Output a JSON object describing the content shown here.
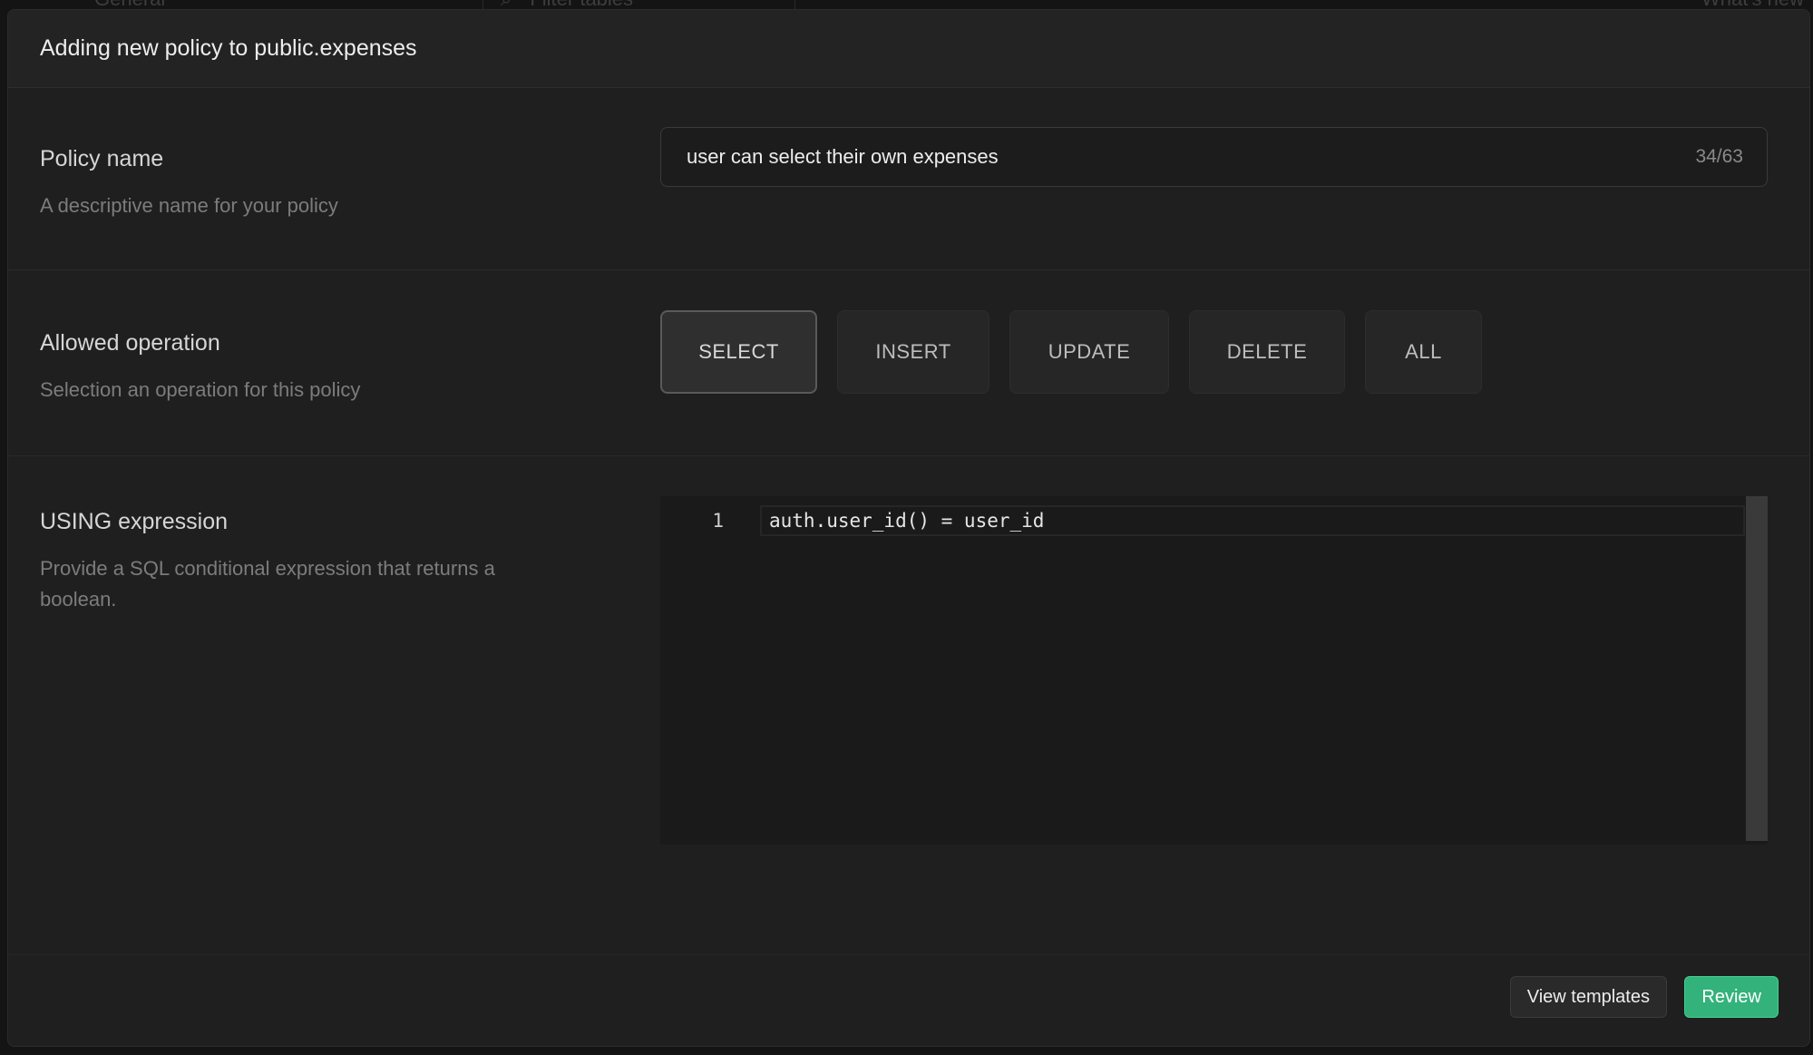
{
  "background": {
    "tab_label": "General",
    "filter_placeholder": "Filter tables",
    "whats_new": "What's new"
  },
  "modal": {
    "title": "Adding new policy to public.expenses",
    "policy_name": {
      "title": "Policy name",
      "description": "A descriptive name for your policy",
      "value": "user can select their own expenses",
      "char_count": "34/63"
    },
    "allowed_operation": {
      "title": "Allowed operation",
      "description": "Selection an operation for this policy",
      "options": [
        "SELECT",
        "INSERT",
        "UPDATE",
        "DELETE",
        "ALL"
      ],
      "selected": "SELECT"
    },
    "using_expression": {
      "title": "USING expression",
      "description": "Provide a SQL conditional expression that returns a boolean.",
      "lines": [
        {
          "number": "1",
          "code": "auth.user_id() = user_id"
        }
      ]
    },
    "footer": {
      "view_templates_label": "View templates",
      "review_label": "Review"
    }
  },
  "colors": {
    "accent_green": "#34b27b",
    "modal_bg": "#1f1f1f",
    "page_bg": "#101010"
  }
}
